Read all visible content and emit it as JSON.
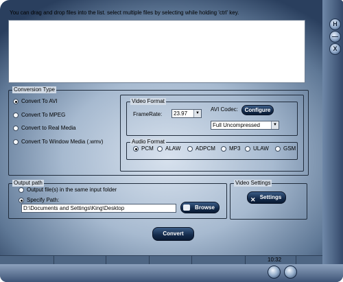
{
  "hint": "You can drag and drop files into the list. select multiple files by selecting while holding 'ctrl' key.",
  "window_buttons": [
    "H",
    "—",
    "X"
  ],
  "conversion_type": {
    "title": "Conversion Type",
    "options": [
      "Convert To AVI",
      "Convert To MPEG",
      "Convert to Real Media",
      "Convert To Window Media (.wmv)"
    ],
    "selected": 0
  },
  "video_format": {
    "title": "Video Format",
    "framerate_label": "FrameRate:",
    "framerate_value": "23.97",
    "avi_codec_label": "AVI Codec:",
    "configure_label": "Configure",
    "codec_value": "Full Uncompressed"
  },
  "audio_format": {
    "title": "Audio Format",
    "options": [
      "PCM",
      "ALAW",
      "ADPCM",
      "MP3",
      "ULAW",
      "GSM"
    ],
    "selected": 0
  },
  "output_path": {
    "title": "Output path",
    "options": [
      "Output file(s) in the same input folder",
      "Specify Path:"
    ],
    "selected": 1,
    "path_value": "D:\\Documents and Settings\\King\\Desktop",
    "browse_label": "Browse"
  },
  "video_settings": {
    "title": "Video Settings",
    "settings_label": "Settings"
  },
  "convert_label": "Convert",
  "status": {
    "time": "10:32"
  }
}
